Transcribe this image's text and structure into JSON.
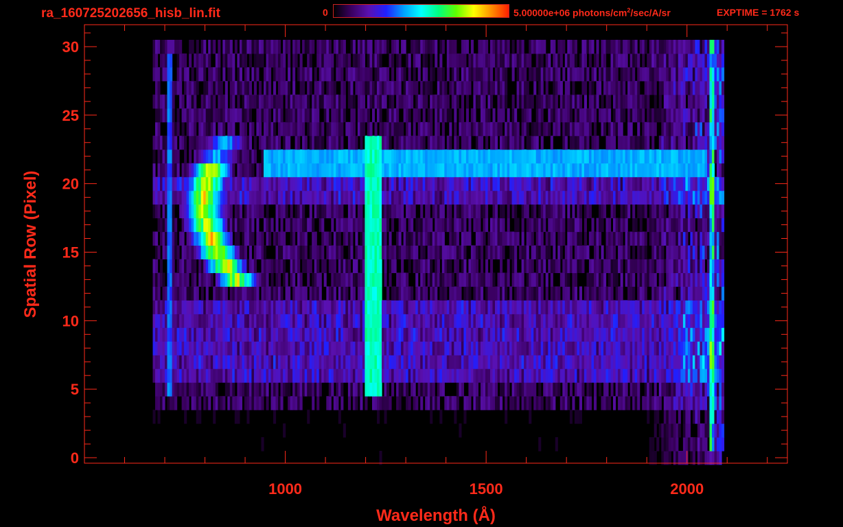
{
  "title": "ra_160725202656_hisb_lin.fit",
  "colorbar": {
    "min_label": "0",
    "max_label_prefix": "5.00000e+06 photons/cm",
    "max_label_sup": "2",
    "max_label_suffix": "/sec/A/sr",
    "colors": [
      "#000000",
      "#3a0060",
      "#5a10b0",
      "#2020ff",
      "#00a0ff",
      "#00ffff",
      "#00ff80",
      "#60ff00",
      "#ffff00",
      "#ff9000",
      "#ff2000"
    ]
  },
  "exptime_label": "EXPTIME = 1762 s",
  "chart_data": {
    "type": "heatmap",
    "xlabel": "Wavelength (Å)",
    "ylabel": "Spatial Row (Pixel)",
    "xlim": [
      500,
      2250
    ],
    "ylim": [
      -0.4,
      31.6
    ],
    "xticks": [
      1000,
      1500,
      2000
    ],
    "yticks": [
      0,
      5,
      10,
      15,
      20,
      25,
      30
    ],
    "axis_color": "#ff2a1a",
    "data_extent_x": [
      670,
      2090
    ],
    "features": [
      {
        "name": "",
        "type": "band",
        "wavelength": 1216,
        "width": 45,
        "rows": [
          5,
          24
        ],
        "level": 0.5
      },
      {
        "name": "",
        "type": "arc",
        "wavelength_center": 820,
        "rows": [
          13,
          24
        ],
        "peak_level": 0.9
      },
      {
        "name": "",
        "type": "row",
        "row": 21.5,
        "wavelength_range": [
          940,
          2050
        ],
        "level": 0.38
      },
      {
        "name": "",
        "type": "edge",
        "wavelength": 2060,
        "level": 0.55
      }
    ]
  }
}
